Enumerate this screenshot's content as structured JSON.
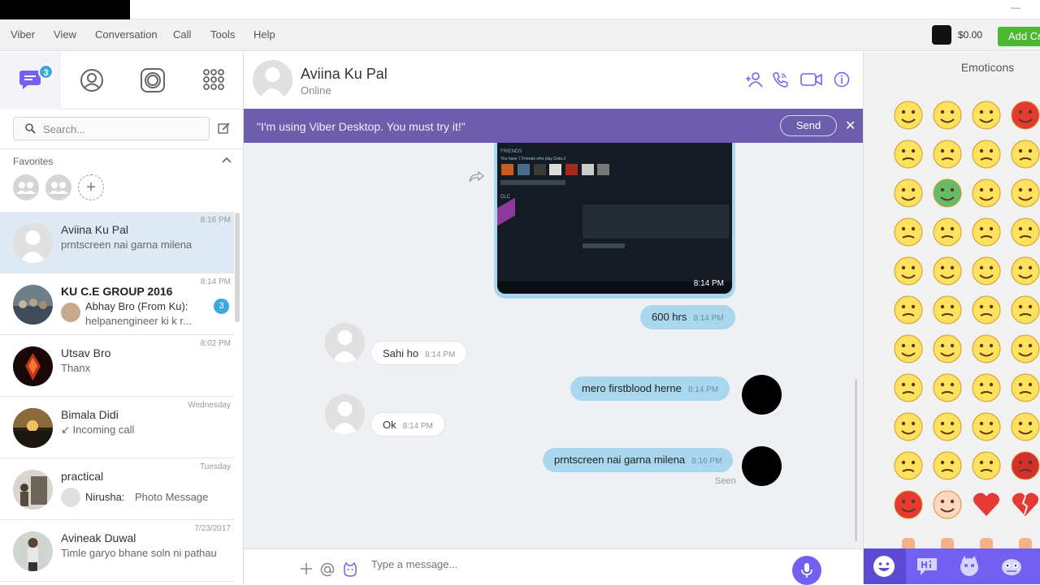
{
  "menu": {
    "items": [
      "Viber",
      "View",
      "Conversation",
      "Call",
      "Tools",
      "Help"
    ],
    "balance": "$0.00",
    "add_credit": "Add Credit"
  },
  "nav": {
    "tabs": [
      "chats-icon",
      "contacts-icon",
      "public-chats-icon",
      "more-apps-icon"
    ],
    "chats_badge": "3"
  },
  "search": {
    "placeholder": "Search..."
  },
  "favorites": {
    "label": "Favorites"
  },
  "chats": [
    {
      "name": "Aviina Ku Pal",
      "message": "prntscreen nai garna milena",
      "time": "8:16 PM"
    },
    {
      "name": "KU C.E GROUP 2016",
      "sender": "Abhay Bro (From Ku):",
      "message": "helpanengineer ki k r...",
      "time": "8:14 PM",
      "unread": "3"
    },
    {
      "name": "Utsav Bro",
      "message": "Thanx",
      "time": "8:02 PM"
    },
    {
      "name": "Bimala Didi",
      "message": "↙ Incoming call",
      "time": "Wednesday"
    },
    {
      "name": "practical",
      "sender": "Nirusha:",
      "message": "Photo Message",
      "time": "Tuesday"
    },
    {
      "name": "Avineak Duwal",
      "message": "Timle garyo bhane soln ni pathau",
      "time": "7/23/2017"
    }
  ],
  "conversation": {
    "name": "Aviina Ku Pal",
    "status": "Online",
    "banner_text": "\"I'm using Viber Desktop. You must try it!\"",
    "banner_send": "Send",
    "banner_close": "✕",
    "messages": [
      {
        "text": "600 hrs",
        "time": "8:14 PM",
        "dir": "out"
      },
      {
        "text": "Sahi ho",
        "time": "8:14 PM",
        "dir": "in"
      },
      {
        "text": "mero firstblood herne",
        "time": "8:14 PM",
        "dir": "out"
      },
      {
        "text": "Ok",
        "time": "8:14 PM",
        "dir": "in"
      },
      {
        "text": "prntscreen nai garna milena",
        "time": "8:16 PM",
        "dir": "out"
      }
    ],
    "image_time": "8:14 PM",
    "seen": "Seen",
    "composer_placeholder": "Type a message..."
  },
  "screenshot_thumb": {
    "friends_label": "FRIENDS",
    "friends_line": "You have 7 Friends who play Dota 2",
    "dlc_label": "DLC"
  },
  "emoticons": {
    "title": "Emoticons"
  }
}
